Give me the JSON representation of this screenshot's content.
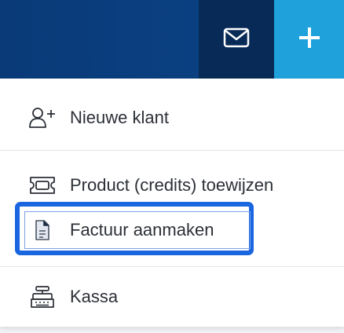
{
  "header": {
    "mail_icon": "envelope-icon",
    "add_icon": "plus-icon"
  },
  "menu": {
    "items": [
      {
        "label": "Nieuwe klant",
        "icon": "add-user-icon"
      },
      {
        "label": "Product (credits) toewijzen",
        "icon": "ticket-icon"
      },
      {
        "label": "Factuur aanmaken",
        "icon": "invoice-document-icon",
        "focused": true
      },
      {
        "label": "Kassa",
        "icon": "cash-register-icon"
      }
    ]
  },
  "colors": {
    "header_blue": "#0a3a78",
    "mail_button": "#082a57",
    "add_button": "#1fa2dc",
    "focus_ring": "#1a66e0"
  }
}
